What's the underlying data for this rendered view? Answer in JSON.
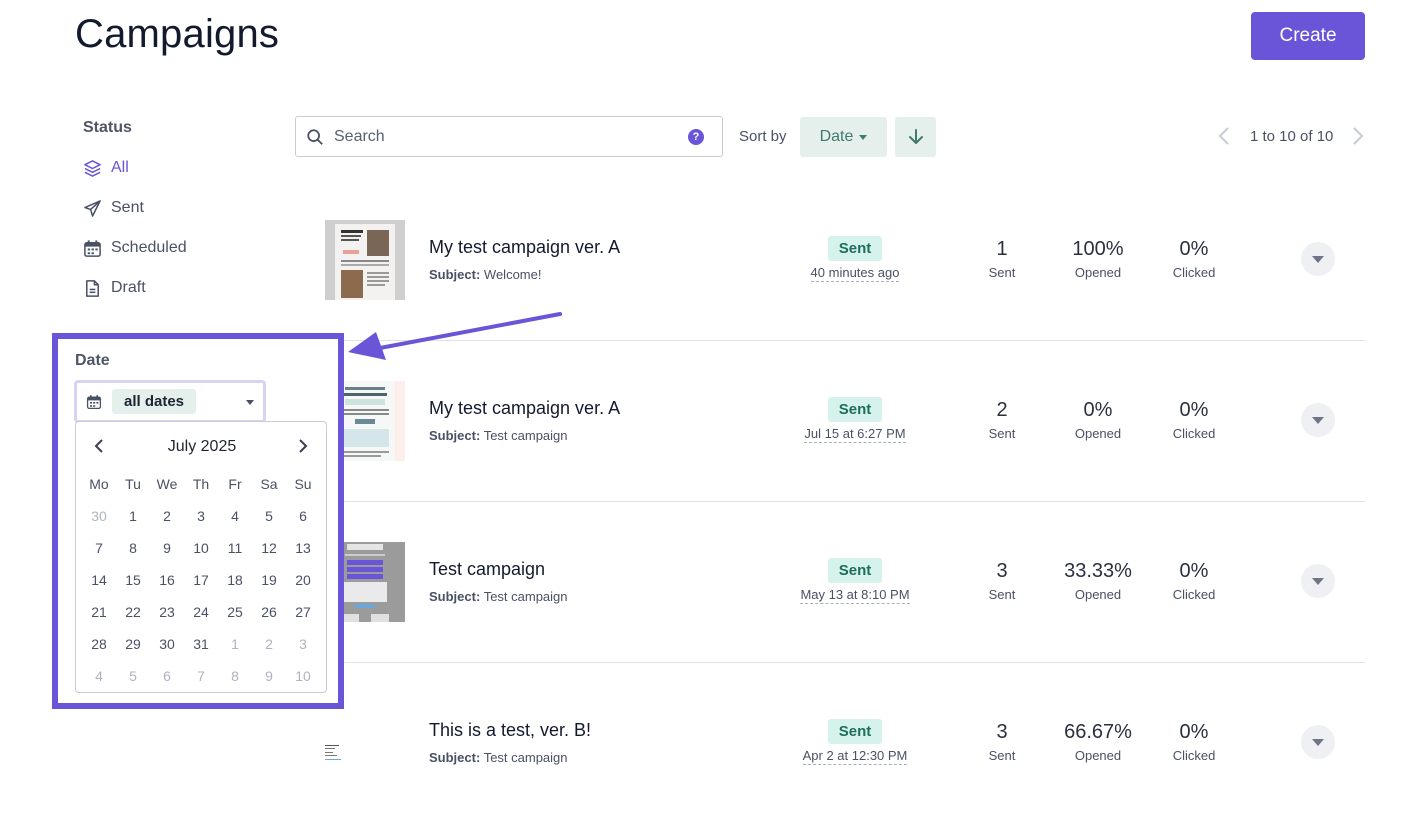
{
  "header": {
    "title": "Campaigns",
    "create_label": "Create"
  },
  "sidebar": {
    "status_heading": "Status",
    "items": [
      {
        "label": "All",
        "icon": "layers-icon",
        "active": true
      },
      {
        "label": "Sent",
        "icon": "paper-plane-icon"
      },
      {
        "label": "Scheduled",
        "icon": "calendar-icon"
      },
      {
        "label": "Draft",
        "icon": "document-icon"
      }
    ],
    "date_heading": "Date",
    "date_value": "all dates"
  },
  "calendar": {
    "month": "July 2025",
    "weekdays": [
      "Mo",
      "Tu",
      "We",
      "Th",
      "Fr",
      "Sa",
      "Su"
    ],
    "weeks": [
      [
        "30",
        "1",
        "2",
        "3",
        "4",
        "5",
        "6"
      ],
      [
        "7",
        "8",
        "9",
        "10",
        "11",
        "12",
        "13"
      ],
      [
        "14",
        "15",
        "16",
        "17",
        "18",
        "19",
        "20"
      ],
      [
        "21",
        "22",
        "23",
        "24",
        "25",
        "26",
        "27"
      ],
      [
        "28",
        "29",
        "30",
        "31",
        "1",
        "2",
        "3"
      ],
      [
        "4",
        "5",
        "6",
        "7",
        "8",
        "9",
        "10"
      ]
    ]
  },
  "toolbar": {
    "search_placeholder": "Search",
    "help_label": "?",
    "sort_by_label": "Sort by",
    "sort_value": "Date",
    "pagination": "1 to 10 of 10"
  },
  "campaigns": [
    {
      "title": "My test campaign ver. A",
      "subject_label": "Subject:",
      "subject": "Welcome!",
      "status": "Sent",
      "sent_time": "40 minutes ago",
      "sent": "1",
      "sent_label": "Sent",
      "opened": "100%",
      "opened_label": "Opened",
      "clicked": "0%",
      "clicked_label": "Clicked"
    },
    {
      "title": "My test campaign ver. A",
      "subject_label": "Subject:",
      "subject": "Test campaign",
      "status": "Sent",
      "sent_time": "Jul 15 at 6:27 PM",
      "sent": "2",
      "sent_label": "Sent",
      "opened": "0%",
      "opened_label": "Opened",
      "clicked": "0%",
      "clicked_label": "Clicked"
    },
    {
      "title": "Test campaign",
      "subject_label": "Subject:",
      "subject": "Test campaign",
      "status": "Sent",
      "sent_time": "May 13 at 8:10 PM",
      "sent": "3",
      "sent_label": "Sent",
      "opened": "33.33%",
      "opened_label": "Opened",
      "clicked": "0%",
      "clicked_label": "Clicked"
    },
    {
      "title": "This is a test, ver. B!",
      "subject_label": "Subject:",
      "subject": "Test campaign",
      "status": "Sent",
      "sent_time": "Apr 2 at 12:30 PM",
      "sent": "3",
      "sent_label": "Sent",
      "opened": "66.67%",
      "opened_label": "Opened",
      "clicked": "0%",
      "clicked_label": "Clicked"
    }
  ],
  "colors": {
    "accent": "#6a55d8",
    "badge_bg": "#d6f2ec",
    "badge_text": "#1d6e5d",
    "sort_bg": "#e5efeb"
  }
}
